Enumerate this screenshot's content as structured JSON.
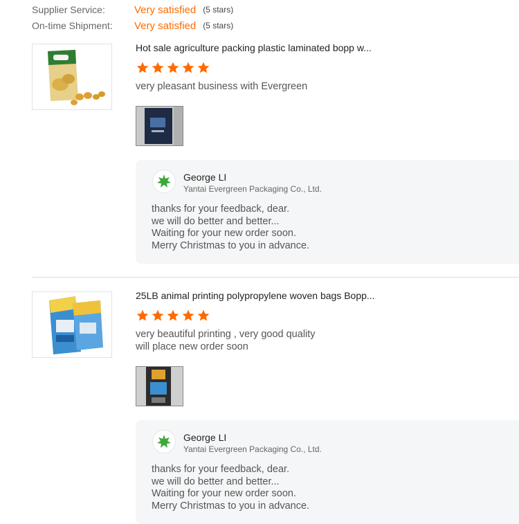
{
  "ratings": [
    {
      "label": "Supplier Service:",
      "value": "Very satisfied",
      "count": "(5 stars)"
    },
    {
      "label": "On-time Shipment:",
      "value": "Very satisfied",
      "count": "(5 stars)"
    }
  ],
  "colors": {
    "accent": "#ff6a00",
    "star": "#ff6a00",
    "leaf": "#3aa93a"
  },
  "reviews": [
    {
      "product_title": "Hot sale agriculture packing plastic laminated bopp w...",
      "stars": 5,
      "text": [
        "very pleasant business with Evergreen"
      ],
      "reply": {
        "name": "George LI",
        "company": "Yantai Evergreen Packaging Co., Ltd.",
        "message": [
          "thanks for your feedback, dear.",
          "we will do better and better...",
          "Waiting for your new order soon.",
          "Merry Christmas to you in advance."
        ]
      }
    },
    {
      "product_title": "25LB animal printing polypropylene woven bags Bopp...",
      "stars": 5,
      "text": [
        "very beautiful printing , very good quality",
        "will place new order soon"
      ],
      "reply": {
        "name": "George LI",
        "company": "Yantai Evergreen Packaging Co., Ltd.",
        "message": [
          "thanks for your feedback, dear.",
          "we will do better and better...",
          "Waiting for your new order soon.",
          "Merry Christmas to you in advance."
        ]
      }
    }
  ]
}
